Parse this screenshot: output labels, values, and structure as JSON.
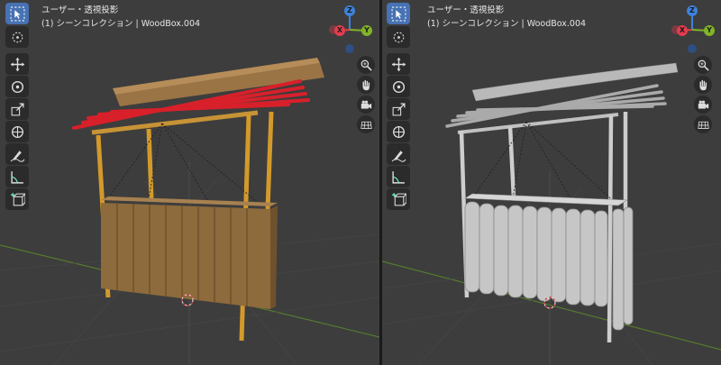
{
  "left_viewport": {
    "mode_label": "ユーザー・透視投影",
    "collection_label": "(1) シーンコレクション | WoodBox.004",
    "shading": "material"
  },
  "right_viewport": {
    "mode_label": "ユーザー・透視投影",
    "collection_label": "(1) シーンコレクション | WoodBox.004",
    "shading": "solid"
  },
  "gizmo": {
    "z": "Z",
    "x": "X",
    "y": "Y"
  },
  "toolbar_tools": [
    "select-box-icon",
    "cursor-icon",
    "move-icon",
    "rotate-icon",
    "scale-icon",
    "transform-icon",
    "annotate-icon",
    "measure-icon",
    "add-cube-icon"
  ],
  "nav_buttons": [
    "zoom-icon",
    "hand-icon",
    "camera-icon",
    "grid-icon"
  ],
  "colors": {
    "accent": "#4772b3",
    "axis_x": "#e33d4e",
    "axis_y": "#80b327",
    "axis_z": "#3c82db"
  }
}
